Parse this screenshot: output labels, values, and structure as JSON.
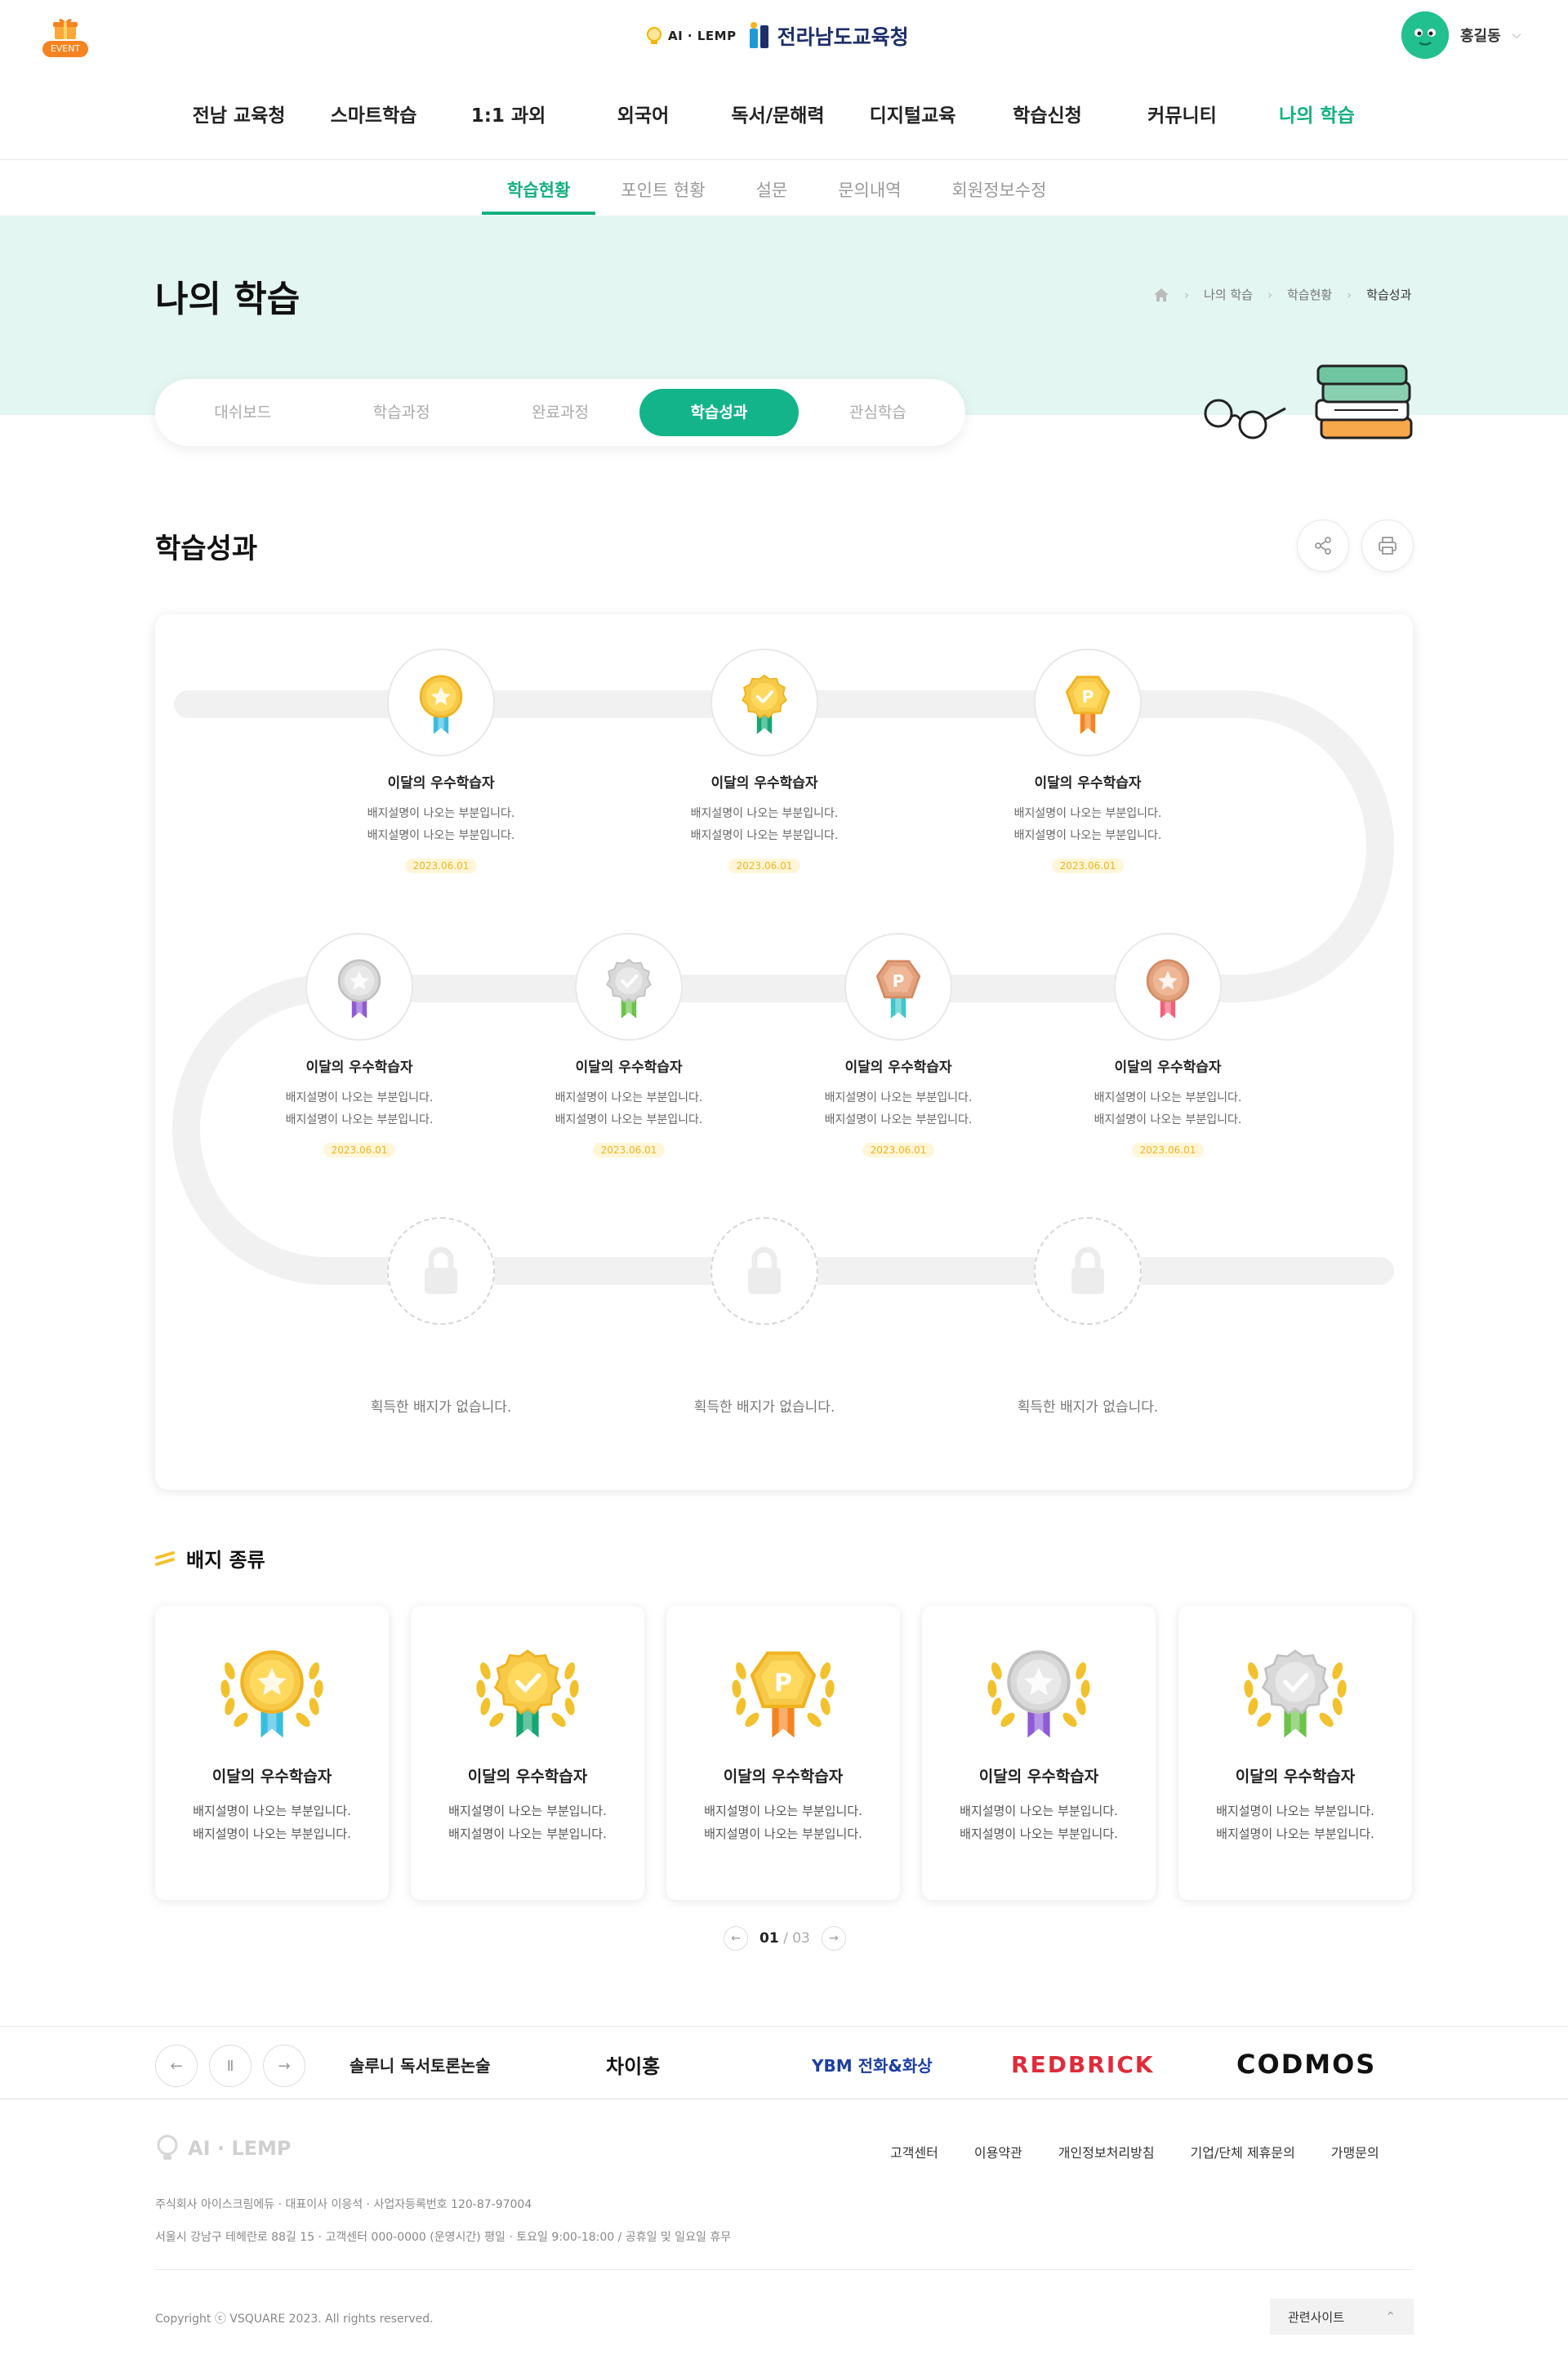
{
  "header": {
    "event_label": "EVENT",
    "service_logo": "AI · LEMP",
    "office_name": "전라남도교육청",
    "user_name": "홍길동",
    "gnb": [
      "전남 교육청",
      "스마트학습",
      "1:1 과외",
      "외국어",
      "독서/문해력",
      "디지털교육",
      "학습신청",
      "커뮤니티",
      "나의 학습"
    ],
    "gnb_active": "나의 학습"
  },
  "subnav": [
    "학습현황",
    "포인트 현황",
    "설문",
    "문의내역",
    "회원정보수정"
  ],
  "hero": {
    "title": "나의 학습",
    "breadcrumb": [
      "나의 학습",
      "학습현황",
      "학습성과"
    ],
    "tabs": [
      "대쉬보드",
      "학습과정",
      "완료과정",
      "학습성과",
      "관심학습"
    ]
  },
  "section_title": "학습성과",
  "achievements": [
    {
      "name": "이달의 우수학습자",
      "desc1": "배지설명이 나오는 부분입니다.",
      "desc2": "배지설명이 나오는 부분입니다.",
      "date": "2023.06.01",
      "type": "gold-star",
      "locked": false
    },
    {
      "name": "이달의 우수학습자",
      "desc1": "배지설명이 나오는 부분입니다.",
      "desc2": "배지설명이 나오는 부분입니다.",
      "date": "2023.06.01",
      "type": "gold-check",
      "locked": false
    },
    {
      "name": "이달의 우수학습자",
      "desc1": "배지설명이 나오는 부분입니다.",
      "desc2": "배지설명이 나오는 부분입니다.",
      "date": "2023.06.01",
      "type": "gold-p",
      "locked": false
    },
    {
      "name": "이달의 우수학습자",
      "desc1": "배지설명이 나오는 부분입니다.",
      "desc2": "배지설명이 나오는 부분입니다.",
      "date": "2023.06.01",
      "type": "silver-star",
      "locked": false
    },
    {
      "name": "이달의 우수학습자",
      "desc1": "배지설명이 나오는 부분입니다.",
      "desc2": "배지설명이 나오는 부분입니다.",
      "date": "2023.06.01",
      "type": "silver-check",
      "locked": false
    },
    {
      "name": "이달의 우수학습자",
      "desc1": "배지설명이 나오는 부분입니다.",
      "desc2": "배지설명이 나오는 부분입니다.",
      "date": "2023.06.01",
      "type": "bronze-p",
      "locked": false
    },
    {
      "name": "이달의 우수학습자",
      "desc1": "배지설명이 나오는 부분입니다.",
      "desc2": "배지설명이 나오는 부분입니다.",
      "date": "2023.06.01",
      "type": "bronze-star",
      "locked": false
    },
    {
      "empty_text": "획득한 배지가 없습니다.",
      "locked": true
    },
    {
      "empty_text": "획득한 배지가 없습니다.",
      "locked": true
    },
    {
      "empty_text": "획득한 배지가 없습니다.",
      "locked": true
    }
  ],
  "badge_kinds_title": "배지 종류",
  "badge_kinds": [
    {
      "name": "이달의 우수학습자",
      "desc1": "배지설명이 나오는 부분입니다.",
      "desc2": "배지설명이 나오는 부분입니다.",
      "type": "gold-star"
    },
    {
      "name": "이달의 우수학습자",
      "desc1": "배지설명이 나오는 부분입니다.",
      "desc2": "배지설명이 나오는 부분입니다.",
      "type": "gold-check"
    },
    {
      "name": "이달의 우수학습자",
      "desc1": "배지설명이 나오는 부분입니다.",
      "desc2": "배지설명이 나오는 부분입니다.",
      "type": "gold-p"
    },
    {
      "name": "이달의 우수학습자",
      "desc1": "배지설명이 나오는 부분입니다.",
      "desc2": "배지설명이 나오는 부분입니다.",
      "type": "silver-star"
    },
    {
      "name": "이달의 우수학습자",
      "desc1": "배지설명이 나오는 부분입니다.",
      "desc2": "배지설명이 나오는 부분입니다.",
      "type": "silver-check"
    }
  ],
  "pager": {
    "current": "01",
    "total": "03"
  },
  "partners": [
    "솔루니 독서토론논술",
    "차이홍",
    "YBM 전화&화상",
    "REDBRICK",
    "CODMOS"
  ],
  "footer": {
    "logo": "AI · LEMP",
    "links": [
      "고객센터",
      "이용약관",
      "개인정보처리방침",
      "기업/단체 제휴문의",
      "가맹문의"
    ],
    "info1": "주식회사 아이스크림에듀  ·  대표이사 이응석  ·  사업자등록번호 120-87-97004",
    "info2": "서울시 강남구 테헤란로 88길 15  ·  고객센터 000-0000 (운영시간) 평일 · 토요일 9:00-18:00 / 공휴일 및 일요일 휴무",
    "copyright": "Copyright ⓒ VSQUARE 2023. All rights reserved.",
    "family_site": "관련사이트"
  },
  "colors": {
    "accent": "#14b48a",
    "gold": "#f7c948",
    "silver": "#d9d9d9",
    "bronze": "#e3a27e",
    "hero_bg": "#e3f6f1"
  }
}
